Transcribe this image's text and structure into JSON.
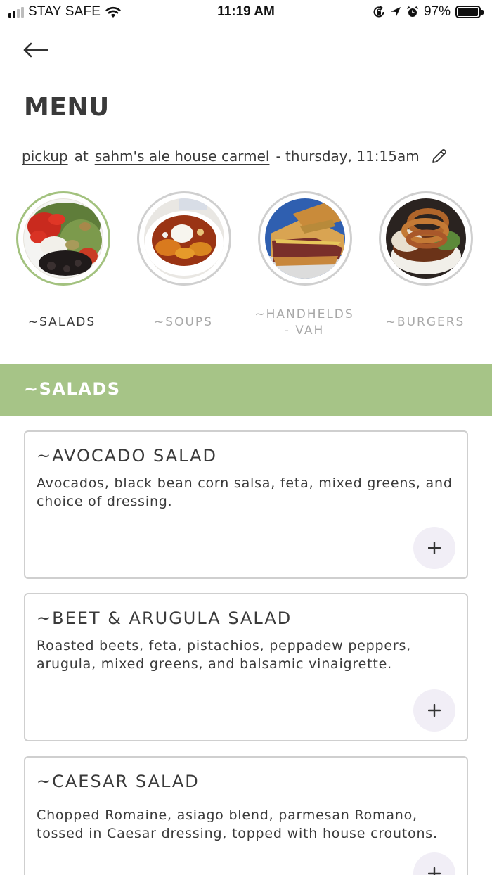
{
  "status_bar": {
    "carrier": "STAY SAFE",
    "time": "11:19 AM",
    "battery": "97%",
    "battery_level": 0.97
  },
  "header": {
    "title": "MENU"
  },
  "order": {
    "mode": "pickup",
    "at": "at",
    "location": "sahm's ale house carmel",
    "time": "- thursday, 11:15am"
  },
  "categories": [
    {
      "label": "~SALADS",
      "active": true
    },
    {
      "label": "~SOUPS",
      "active": false
    },
    {
      "label": "~HANDHELDS - VAH",
      "active": false
    },
    {
      "label": "~BURGERS",
      "active": false
    }
  ],
  "section": {
    "title": "~SALADS"
  },
  "items": [
    {
      "name": "~AVOCADO SALAD",
      "description": "Avocados, black bean corn salsa, feta, mixed greens, and choice of dressing."
    },
    {
      "name": "~BEET & ARUGULA SALAD",
      "description": "Roasted beets, feta, pistachios, peppadew peppers, arugula, mixed greens, and balsamic vinaigrette."
    },
    {
      "name": "~CAESAR SALAD",
      "description": "Chopped Romaine, asiago blend, parmesan Romano, tossed in Caesar dressing, topped with house croutons."
    }
  ],
  "icons": {
    "back": "arrow-left-icon",
    "edit": "pencil-icon",
    "add": "plus-icon"
  },
  "colors": {
    "accent_green": "#a6c487",
    "active_ring": "#a3c27f",
    "add_button_bg": "#f1eef6"
  }
}
